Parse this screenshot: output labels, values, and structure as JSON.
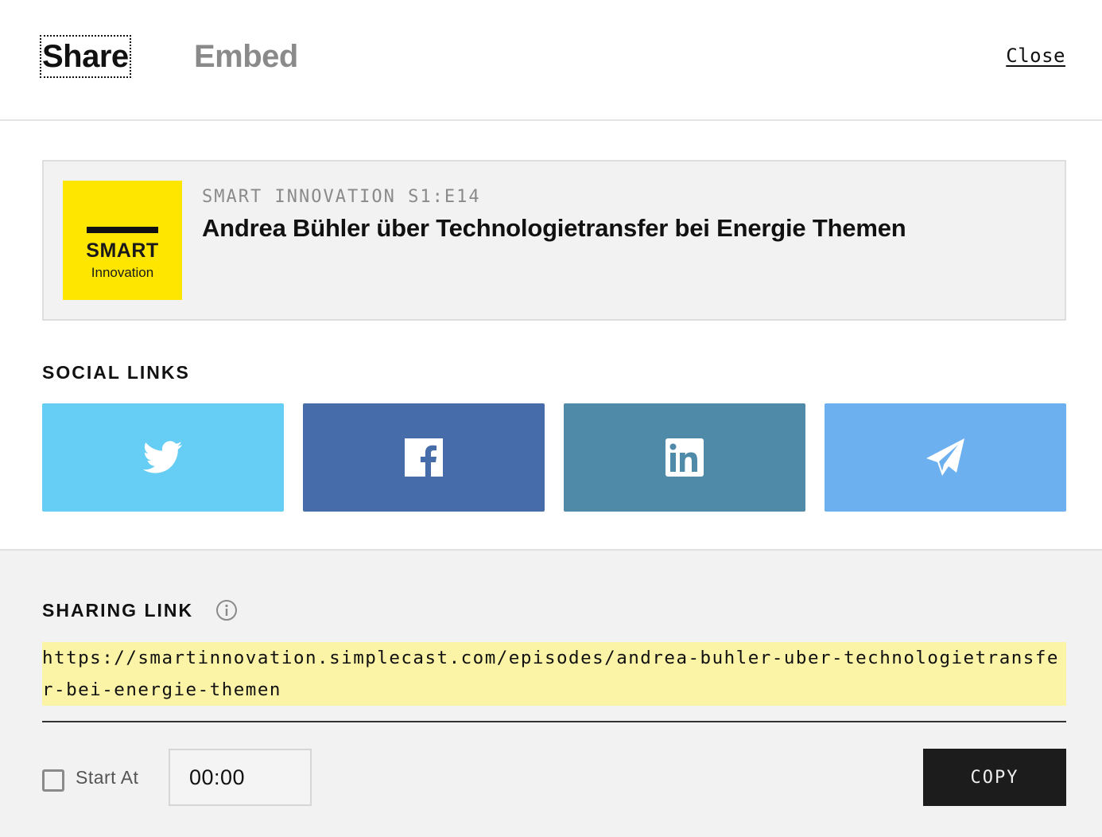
{
  "header": {
    "tabs": [
      {
        "label": "Share",
        "active": true
      },
      {
        "label": "Embed",
        "active": false
      }
    ],
    "close_label": "Close"
  },
  "episode": {
    "cover": {
      "logo_main": "SMART",
      "logo_sub": "Innovation",
      "background_color": "#ffe600"
    },
    "meta": "SMART INNOVATION S1:E14",
    "title": "Andrea Bühler über Technologietransfer bei Energie Themen"
  },
  "social": {
    "label": "SOCIAL LINKS",
    "buttons": [
      {
        "network": "twitter",
        "icon": "twitter-icon",
        "color": "#66cdf4"
      },
      {
        "network": "facebook",
        "icon": "facebook-icon",
        "color": "#466daa"
      },
      {
        "network": "linkedin",
        "icon": "linkedin-icon",
        "color": "#4f8aa9"
      },
      {
        "network": "telegram",
        "icon": "telegram-icon",
        "color": "#6cb0f0"
      }
    ]
  },
  "sharing": {
    "label": "SHARING LINK",
    "info_icon": "info-icon",
    "url": "https://smartinnovation.simplecast.com/episodes/andrea-buhler-uber-technologietransfer-bei-energie-themen",
    "start_at_label": "Start At",
    "start_at_checked": false,
    "start_time": "00:00",
    "copy_label": "COPY"
  }
}
